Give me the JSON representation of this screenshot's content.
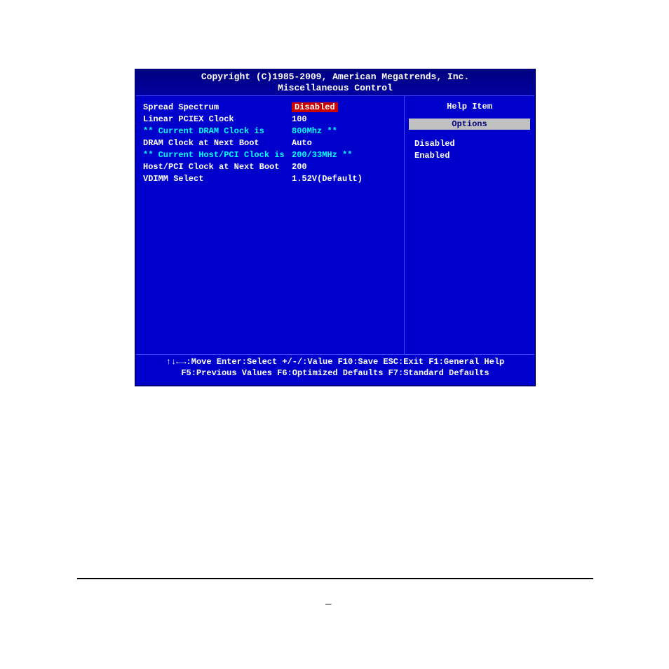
{
  "header": {
    "copyright": "Copyright (C)1985-2009, American Megatrends, Inc.",
    "title": "Miscellaneous Control"
  },
  "settings": [
    {
      "label": "Spread Spectrum",
      "value": "Disabled",
      "selected": true
    },
    {
      "label": "Linear PCIEX Clock",
      "value": "100"
    },
    {
      "label": "** Current DRAM Clock is",
      "value": "800Mhz **",
      "info": true
    },
    {
      "label": "DRAM Clock at Next Boot",
      "value": "Auto"
    },
    {
      "label": "** Current Host/PCI Clock is",
      "value": "200/33MHz **",
      "info": true
    },
    {
      "label": "Host/PCI Clock at Next Boot",
      "value": "200"
    },
    {
      "label": "VDIMM Select",
      "value": "1.52V(Default)"
    }
  ],
  "help": {
    "title": "Help Item",
    "options_header": "Options",
    "options": [
      "Disabled",
      "Enabled"
    ]
  },
  "footer": {
    "line1": "↑↓←→:Move  Enter:Select  +/-/:Value  F10:Save  ESC:Exit  F1:General Help",
    "line2": "F5:Previous Values    F6:Optimized Defaults    F7:Standard Defaults"
  }
}
